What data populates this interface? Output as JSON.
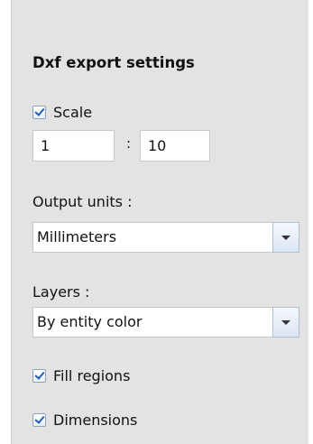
{
  "heading": "Dxf export settings",
  "scale": {
    "label": "Scale",
    "checked": true,
    "left_value": "1",
    "separator": ":",
    "right_value": "10"
  },
  "output_units": {
    "label": "Output units :",
    "value": "Millimeters"
  },
  "layers": {
    "label": "Layers :",
    "value": "By entity color"
  },
  "fill_regions": {
    "label": "Fill regions",
    "checked": true
  },
  "dimensions": {
    "label": "Dimensions",
    "checked": true
  }
}
